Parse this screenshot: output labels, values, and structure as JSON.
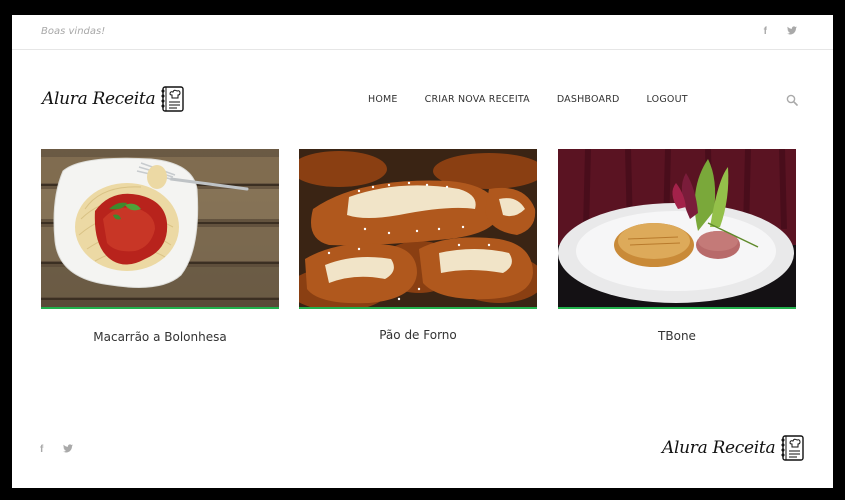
{
  "topbar": {
    "welcome": "Boas vindas!",
    "social": [
      {
        "icon": "facebook-icon",
        "glyph": "f"
      },
      {
        "icon": "twitter-icon",
        "glyph": "t"
      }
    ]
  },
  "header": {
    "logo_text": "Alura Receita",
    "nav": [
      {
        "label": "HOME"
      },
      {
        "label": "CRIAR NOVA RECEITA"
      },
      {
        "label": "DASHBOARD"
      },
      {
        "label": "LOGOUT"
      }
    ],
    "search_icon": "search-icon"
  },
  "recipes": [
    {
      "title": "Macarrão a Bolonhesa"
    },
    {
      "title": "Pão de Forno"
    },
    {
      "title": "TBone"
    }
  ],
  "footer": {
    "logo_text": "Alura Receita"
  },
  "colors": {
    "accent_bar": "#22b14c",
    "muted_text": "#a8a8a8",
    "nav_text": "#333333"
  }
}
